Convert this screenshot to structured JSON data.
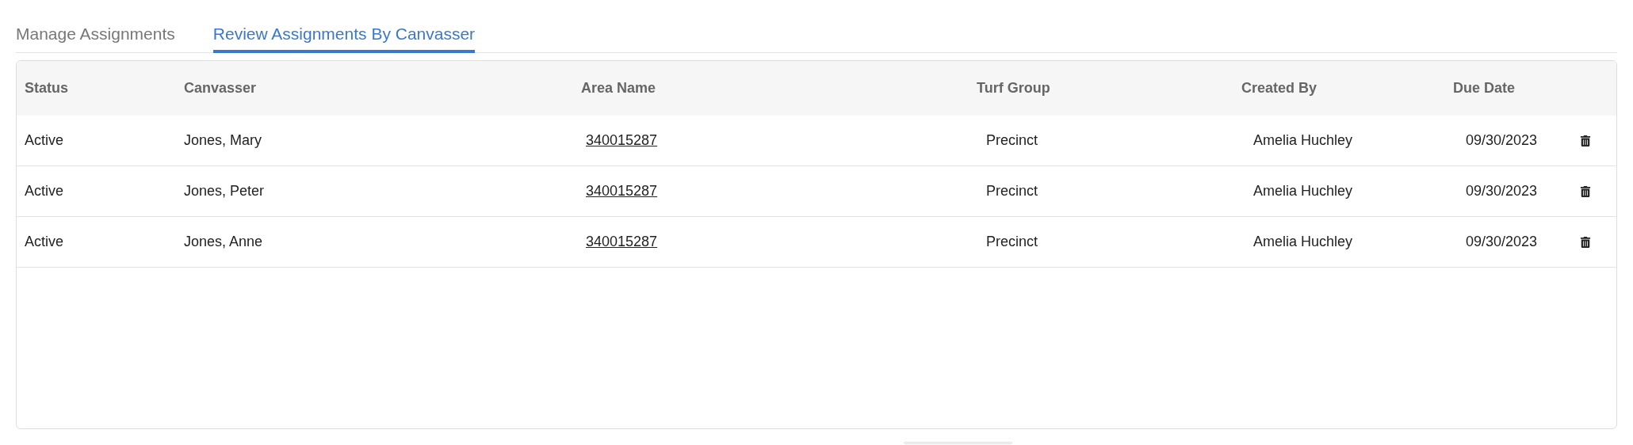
{
  "tabs": [
    {
      "label": "Manage Assignments",
      "selected": false
    },
    {
      "label": "Review Assignments By Canvasser",
      "selected": true
    }
  ],
  "table": {
    "columns": [
      "Status",
      "Canvasser",
      "Area Name",
      "Turf Group",
      "Created By",
      "Due Date"
    ],
    "rows": [
      {
        "status": "Active",
        "canvasser": "Jones, Mary",
        "area_name": "340015287",
        "turf_group": "Precinct",
        "created_by": "Amelia Huchley",
        "due_date": "09/30/2023"
      },
      {
        "status": "Active",
        "canvasser": "Jones, Peter",
        "area_name": "340015287",
        "turf_group": "Precinct",
        "created_by": "Amelia Huchley",
        "due_date": "09/30/2023"
      },
      {
        "status": "Active",
        "canvasser": "Jones, Anne",
        "area_name": "340015287",
        "turf_group": "Precinct",
        "created_by": "Amelia Huchley",
        "due_date": "09/30/2023"
      }
    ]
  }
}
